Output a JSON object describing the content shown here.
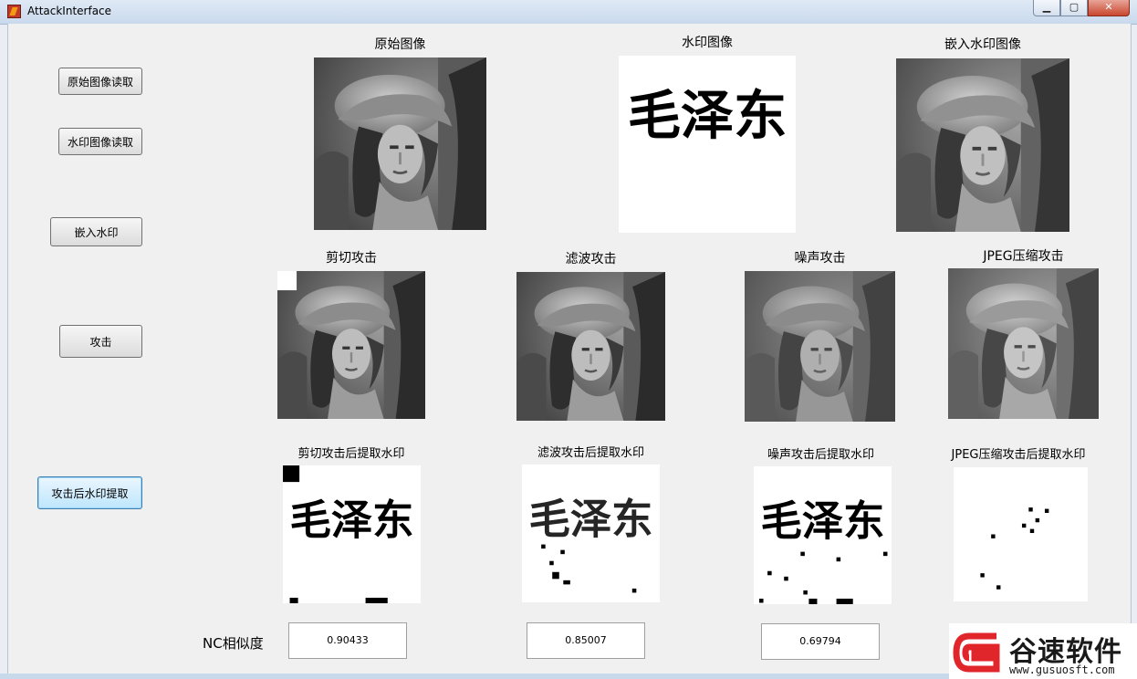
{
  "window": {
    "title": "AttackInterface"
  },
  "buttons": {
    "read_original": "原始图像读取",
    "read_watermark": "水印图像读取",
    "embed": "嵌入水印",
    "attack": "攻击",
    "extract_after_attack": "攻击后水印提取"
  },
  "captions": {
    "original": "原始图像",
    "watermark": "水印图像",
    "embedded": "嵌入水印图像",
    "crop_attack": "剪切攻击",
    "filter_attack": "滤波攻击",
    "noise_attack": "噪声攻击",
    "jpeg_attack": "JPEG压缩攻击",
    "crop_extract": "剪切攻击后提取水印",
    "filter_extract": "滤波攻击后提取水印",
    "noise_extract": "噪声攻击后提取水印",
    "jpeg_extract": "JPEG压缩攻击后提取水印"
  },
  "watermark_text": "毛泽东",
  "nc": {
    "label": "NC相似度",
    "crop": "0.90433",
    "filter": "0.85007",
    "noise": "0.69794",
    "jpeg": ""
  },
  "brand": {
    "name": "谷速软件",
    "url": "www.gusuosft.com"
  },
  "colors": {
    "brand_red": "#e0262b",
    "focus_blue": "#3c7fb1"
  }
}
